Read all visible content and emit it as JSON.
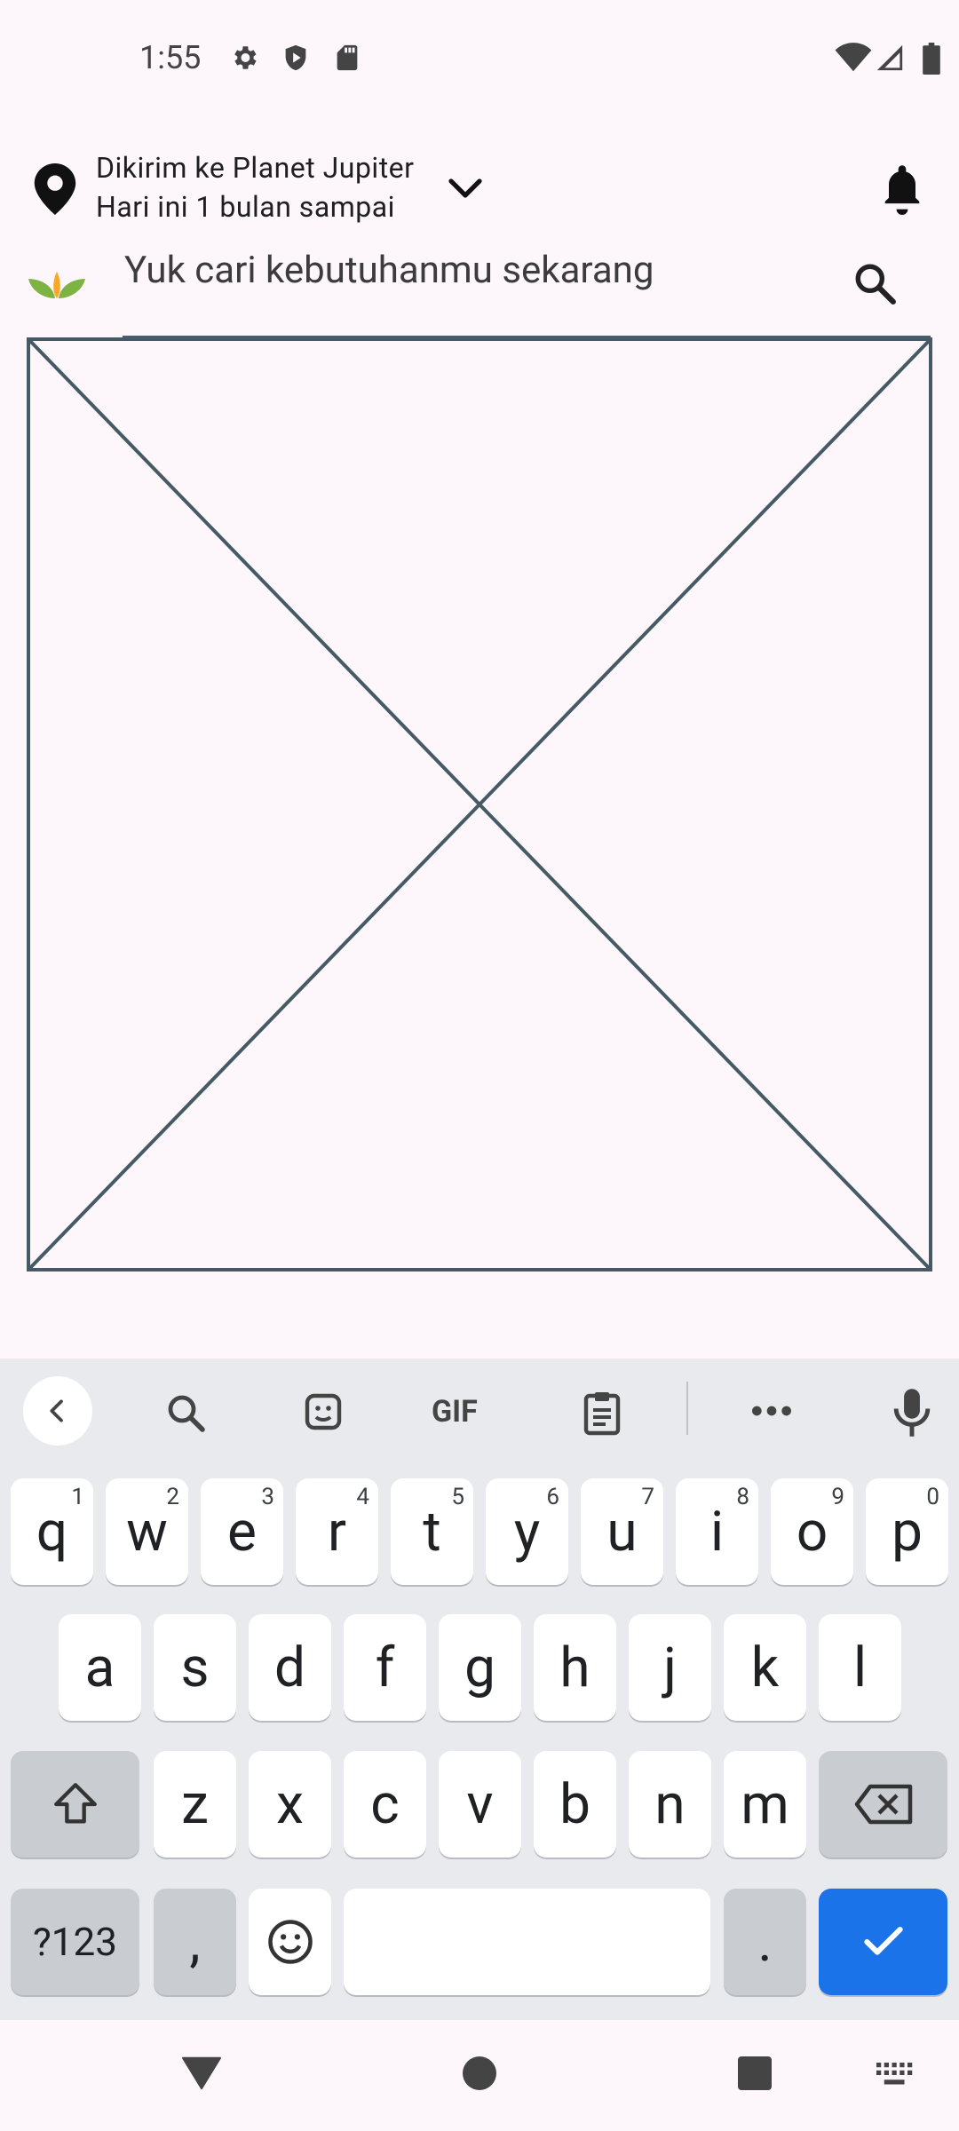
{
  "status_bar": {
    "time": "1:55",
    "icons": [
      "gear-icon",
      "shield-play-icon",
      "sd-card-icon",
      "wifi-icon",
      "signal-icon",
      "battery-icon"
    ]
  },
  "header": {
    "location_line1": "Dikirim ke Planet Jupiter",
    "location_line2": "Hari ini 1 bulan sampai"
  },
  "search": {
    "placeholder": "Yuk cari kebutuhanmu sekarang"
  },
  "keyboard": {
    "toolbar": [
      "back-chevron-icon",
      "search-icon",
      "sticker-icon",
      "GIF",
      "clipboard-icon",
      "more-icon",
      "mic-icon"
    ],
    "row1": [
      {
        "k": "q",
        "h": "1"
      },
      {
        "k": "w",
        "h": "2"
      },
      {
        "k": "e",
        "h": "3"
      },
      {
        "k": "r",
        "h": "4"
      },
      {
        "k": "t",
        "h": "5"
      },
      {
        "k": "y",
        "h": "6"
      },
      {
        "k": "u",
        "h": "7"
      },
      {
        "k": "i",
        "h": "8"
      },
      {
        "k": "o",
        "h": "9"
      },
      {
        "k": "p",
        "h": "0"
      }
    ],
    "row2": [
      "a",
      "s",
      "d",
      "f",
      "g",
      "h",
      "j",
      "k",
      "l"
    ],
    "row3": [
      "z",
      "x",
      "c",
      "v",
      "b",
      "n",
      "m"
    ],
    "symbols_label": "?123",
    "comma_label": ",",
    "period_label": "."
  },
  "colors": {
    "background": "#fdf6fb",
    "keyboard_bg": "#e8eaed",
    "done_key": "#1a73e8",
    "leaf_green": "#7cb342",
    "leaf_yellow": "#f9a825"
  }
}
